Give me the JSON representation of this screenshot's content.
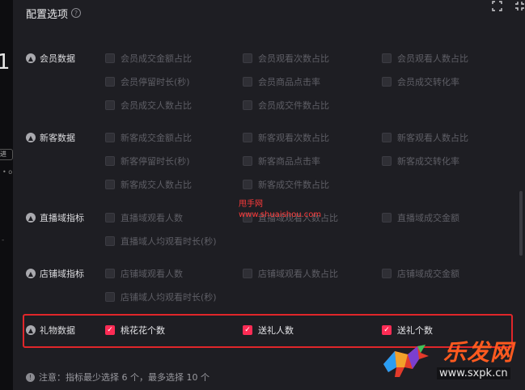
{
  "background": {
    "digit": "1",
    "tag": "进入",
    "dot": "• o",
    "dash": "-"
  },
  "header": {
    "title": "配置选项",
    "help": "?"
  },
  "sections": [
    {
      "label": "会员数据",
      "options": [
        {
          "label": "会员成交金额占比",
          "checked": false
        },
        {
          "label": "会员观看次数占比",
          "checked": false
        },
        {
          "label": "会员观看人数占比",
          "checked": false
        },
        {
          "label": "会员停留时长(秒)",
          "checked": false
        },
        {
          "label": "会员商品点击率",
          "checked": false
        },
        {
          "label": "会员成交转化率",
          "checked": false
        },
        {
          "label": "会员成交人数占比",
          "checked": false
        },
        {
          "label": "会员成交件数占比",
          "checked": false
        }
      ]
    },
    {
      "label": "新客数据",
      "options": [
        {
          "label": "新客成交金额占比",
          "checked": false
        },
        {
          "label": "新客观看次数占比",
          "checked": false
        },
        {
          "label": "新客观看人数占比",
          "checked": false
        },
        {
          "label": "新客停留时长(秒)",
          "checked": false
        },
        {
          "label": "新客商品点击率",
          "checked": false
        },
        {
          "label": "新客成交转化率",
          "checked": false
        },
        {
          "label": "新客成交人数占比",
          "checked": false
        },
        {
          "label": "新客成交件数占比",
          "checked": false
        }
      ]
    },
    {
      "label": "直播域指标",
      "options": [
        {
          "label": "直播域观看人数",
          "checked": false
        },
        {
          "label": "直播域观看人数占比",
          "checked": false
        },
        {
          "label": "直播域成交金额",
          "checked": false
        },
        {
          "label": "直播域人均观看时长(秒)",
          "checked": false
        }
      ]
    },
    {
      "label": "店铺域指标",
      "options": [
        {
          "label": "店铺域观看人数",
          "checked": false
        },
        {
          "label": "店铺域观看人数占比",
          "checked": false
        },
        {
          "label": "店铺域成交金额",
          "checked": false
        },
        {
          "label": "店铺域人均观看时长(秒)",
          "checked": false
        }
      ]
    },
    {
      "label": "礼物数据",
      "options": [
        {
          "label": "桃花花个数",
          "checked": true
        },
        {
          "label": "送礼人数",
          "checked": true
        },
        {
          "label": "送礼个数",
          "checked": true
        }
      ]
    }
  ],
  "note": "注意：指标最少选择 6 个，最多选择 10 个",
  "watermarks": {
    "site_name": "甩手网",
    "site_url": "www.shuaishou.com",
    "brand": "乐发网",
    "brand_url": "www.sxpk.cn"
  },
  "colors": {
    "accent": "#fe2c55",
    "highlight_border": "#e0262a",
    "panel_bg": "#1e1e23"
  }
}
